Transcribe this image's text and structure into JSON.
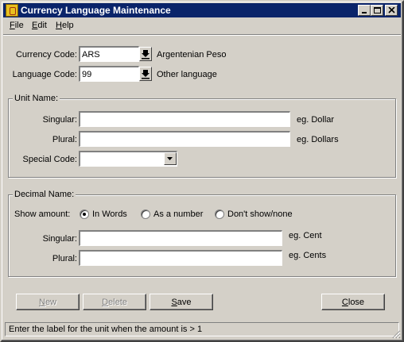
{
  "window": {
    "title": "Currency Language Maintenance"
  },
  "menu": {
    "file": "File",
    "edit": "Edit",
    "help": "Help"
  },
  "currency": {
    "label": "Currency Code:",
    "value": "ARS",
    "description": "Argentenian Peso"
  },
  "language": {
    "label": "Language Code:",
    "value": "99",
    "description": "Other language"
  },
  "unit": {
    "legend": "Unit Name:",
    "singular_label": "Singular:",
    "singular_value": "",
    "singular_example": "eg. Dollar",
    "plural_label": "Plural:",
    "plural_value": "",
    "plural_example": "eg. Dollars",
    "special_label": "Special Code:",
    "special_value": ""
  },
  "decimal": {
    "legend": "Decimal Name:",
    "show_label": "Show amount:",
    "options": [
      "In Words",
      "As a number",
      "Don't show/none"
    ],
    "selected": "In Words",
    "singular_label": "Singular:",
    "singular_value": "",
    "singular_example": "eg. Cent",
    "plural_label": "Plural:",
    "plural_value": "",
    "plural_example": "eg. Cents"
  },
  "buttons": {
    "new": "New",
    "delete": "Delete",
    "save": "Save",
    "close": "Close"
  },
  "status": "Enter the label for the unit when the amount is > 1"
}
